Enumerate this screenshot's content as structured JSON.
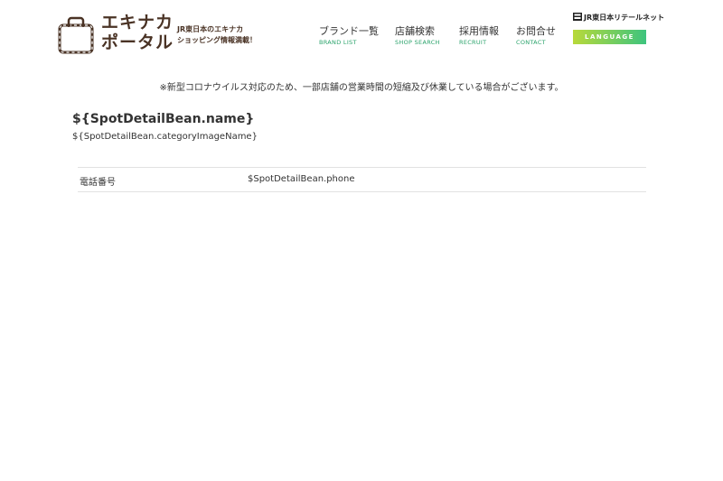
{
  "header": {
    "logo": {
      "line1": "エキナカ",
      "line2": "ポータル"
    },
    "tagline": {
      "line1": "JR東日本のエキナカ",
      "line2": "ショッピング情報満載！"
    },
    "nav": [
      {
        "jp": "ブランド一覧",
        "en": "BRAND LIST"
      },
      {
        "jp": "店舗検索",
        "en": "SHOP SEARCH"
      },
      {
        "jp": "採用情報",
        "en": "RECRUIT"
      },
      {
        "jp": "お問合せ",
        "en": "CONTACT"
      }
    ],
    "retail_net": "JR東日本リテールネット",
    "language_label": "LANGUAGE"
  },
  "notice": "※新型コロナウイルス対応のため、一部店舗の営業時間の短縮及び休業している場合がございます。",
  "spot": {
    "name": "${SpotDetailBean.name}",
    "category": "${SpotDetailBean.categoryImageName}"
  },
  "info_rows": [
    {
      "label": "電話番号",
      "value": "$SpotDetailBean.phone"
    }
  ],
  "colors": {
    "brand_brown": "#4a3325",
    "nav_accent_green": "#2aa36b",
    "language_gradient_start": "#b8d93a",
    "language_gradient_end": "#3ec47e"
  }
}
